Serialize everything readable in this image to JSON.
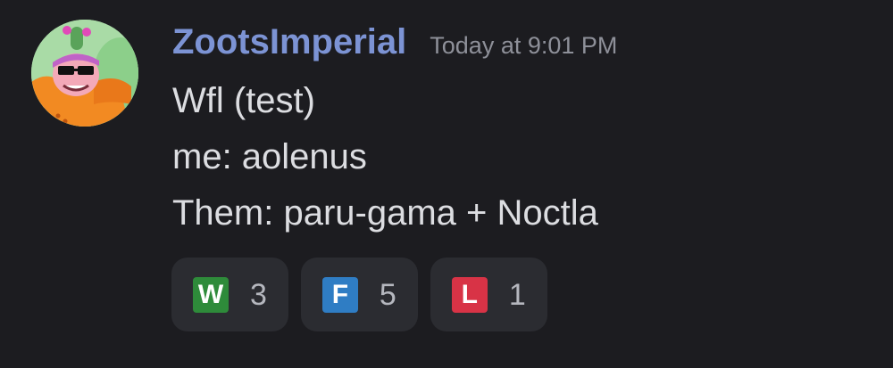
{
  "message": {
    "username": "ZootsImperial",
    "timestamp": "Today at 9:01 PM",
    "lines": [
      "Wfl (test)",
      "me: aolenus",
      "Them: paru-gama + Noctla"
    ]
  },
  "reactions": [
    {
      "emoji_letter": "W",
      "icon": "w-letter-emoji-icon",
      "color": "#2e8b3a",
      "count": "3"
    },
    {
      "emoji_letter": "F",
      "icon": "f-letter-emoji-icon",
      "color": "#2f7dc4",
      "count": "5"
    },
    {
      "emoji_letter": "L",
      "icon": "l-letter-emoji-icon",
      "color": "#d83346",
      "count": "1"
    }
  ],
  "colors": {
    "background": "#1c1c20",
    "username": "#7c93d4",
    "timestamp": "#8e9099",
    "text": "#dcdde1",
    "reaction_bg": "#2b2c31"
  }
}
